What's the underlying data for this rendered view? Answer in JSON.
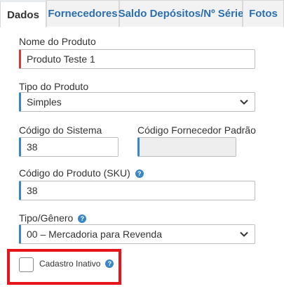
{
  "tabs": [
    {
      "label": "Dados",
      "active": true
    },
    {
      "label": "Fornecedores",
      "active": false
    },
    {
      "label": "Saldo Depósitos/Nº Série",
      "active": false
    },
    {
      "label": "Fotos",
      "active": false
    }
  ],
  "form": {
    "nome_produto": {
      "label": "Nome do Produto",
      "value": "Produto Teste 1"
    },
    "tipo_produto": {
      "label": "Tipo do Produto",
      "value": "Simples"
    },
    "codigo_sistema": {
      "label": "Código do Sistema",
      "value": "38"
    },
    "codigo_fornecedor": {
      "label": "Código Fornecedor Padrão",
      "value": ""
    },
    "codigo_sku": {
      "label": "Código do Produto (SKU)",
      "value": "38"
    },
    "tipo_genero": {
      "label": "Tipo/Gênero",
      "value": "00 – Mercadoria para Revenda"
    },
    "cadastro_inativo": {
      "label": "Cadastro Inativo",
      "checked": false
    }
  },
  "help_glyph": "?",
  "colors": {
    "accent": "#3a87c8",
    "required": "#d9363e",
    "highlight": "#e8141b",
    "tab_link": "#2a6fb0"
  }
}
